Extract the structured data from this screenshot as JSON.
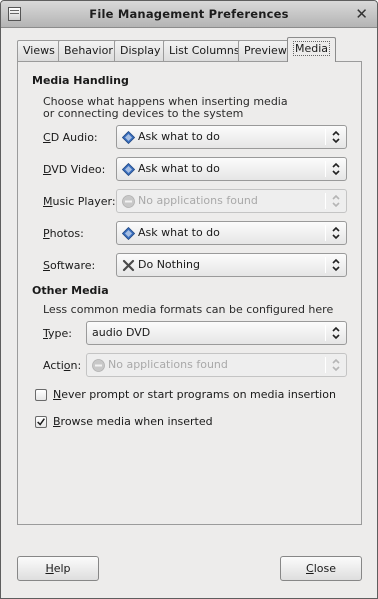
{
  "window": {
    "title": "File Management Preferences"
  },
  "tabs": [
    {
      "label": "Views"
    },
    {
      "label": "Behavior"
    },
    {
      "label": "Display"
    },
    {
      "label": "List Columns"
    },
    {
      "label": "Preview"
    },
    {
      "label": "Media",
      "active": true
    }
  ],
  "media_handling": {
    "heading": "Media Handling",
    "description_line1": "Choose what happens when inserting media",
    "description_line2": "or connecting devices to the system",
    "rows": [
      {
        "label_first": "C",
        "label_rest": "D Audio:",
        "value": "Ask what to do",
        "icon": "ask-icon",
        "enabled": true
      },
      {
        "label_first": "D",
        "label_rest": "VD Video:",
        "value": "Ask what to do",
        "icon": "ask-icon",
        "enabled": true
      },
      {
        "label_first": "M",
        "label_rest": "usic Player:",
        "value": "No applications found",
        "icon": "none-icon",
        "enabled": false
      },
      {
        "label_first": "P",
        "label_rest": "hotos:",
        "value": "Ask what to do",
        "icon": "ask-icon",
        "enabled": true
      },
      {
        "label_first": "S",
        "label_rest": "oftware:",
        "value": "Do Nothing",
        "icon": "do-nothing-icon",
        "enabled": true
      }
    ]
  },
  "other_media": {
    "heading": "Other Media",
    "description": "Less common media formats can be configured here",
    "type_label_first": "T",
    "type_label_rest": "ype:",
    "type_value": "audio DVD",
    "action_label_first": "Acti",
    "action_label_u": "o",
    "action_label_rest": "n:",
    "action_value": "No applications found"
  },
  "checkboxes": {
    "never_prompt": {
      "label_first": "N",
      "label_rest": "ever prompt or start programs on media insertion",
      "checked": false
    },
    "browse_media": {
      "label_first": "B",
      "label_rest": "rowse media when inserted",
      "checked": true
    }
  },
  "buttons": {
    "help_first": "H",
    "help_rest": "elp",
    "close_first": "C",
    "close_rest": "lose"
  },
  "colors": {
    "window_bg": "#edeceb",
    "ask_icon_blue": "#3a6fbf",
    "disabled_text": "#a9a9a9"
  }
}
